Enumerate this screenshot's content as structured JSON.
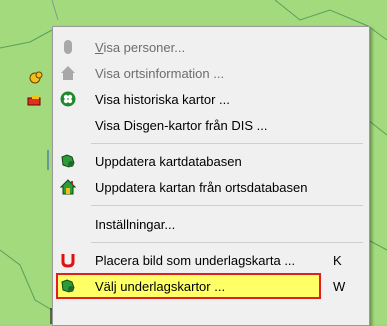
{
  "menu": {
    "items": [
      {
        "label": "Visa personer...",
        "shortcut": "",
        "icon": "person-silhouette-icon",
        "disabled": true
      },
      {
        "label": "Visa ortsinformation ...",
        "shortcut": "",
        "icon": "house-icon",
        "disabled": true
      },
      {
        "label": "Visa historiska kartor ...",
        "shortcut": "",
        "icon": "green-clover-icon",
        "disabled": false
      },
      {
        "label": "Visa Disgen-kartor från DIS ...",
        "shortcut": "",
        "icon": "",
        "disabled": false
      },
      {
        "label": "Uppdatera kartdatabasen",
        "shortcut": "",
        "icon": "map-update-icon",
        "disabled": false
      },
      {
        "label": "Uppdatera kartan från ortsdatabasen",
        "shortcut": "",
        "icon": "house-update-icon",
        "disabled": false
      },
      {
        "label": "Inställningar...",
        "shortcut": "",
        "icon": "",
        "disabled": false
      },
      {
        "label": "Placera bild som underlagskarta ...",
        "shortcut": "K",
        "icon": "red-u-icon",
        "disabled": false
      },
      {
        "label": "Välj underlagskartor ...",
        "shortcut": "W",
        "icon": "map-select-icon",
        "disabled": false
      }
    ]
  },
  "colors": {
    "map_background": "#9fd87a",
    "menu_background": "#f0f0f0",
    "highlight": "#ffff66",
    "highlight_border": "#e02020"
  }
}
